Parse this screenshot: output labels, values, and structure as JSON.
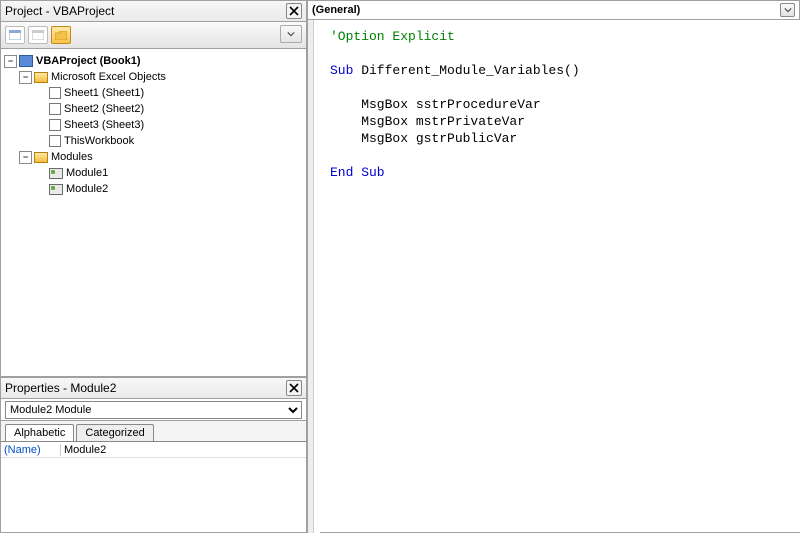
{
  "project_panel": {
    "title": "Project - VBAProject",
    "tree": {
      "root": "VBAProject (Book1)",
      "excel_objects": {
        "label": "Microsoft Excel Objects",
        "items": [
          "Sheet1 (Sheet1)",
          "Sheet2 (Sheet2)",
          "Sheet3 (Sheet3)",
          "ThisWorkbook"
        ]
      },
      "modules": {
        "label": "Modules",
        "items": [
          "Module1",
          "Module2"
        ]
      }
    }
  },
  "properties_panel": {
    "title": "Properties - Module2",
    "object_selector": "Module2 Module",
    "tabs": {
      "alphabetic": "Alphabetic",
      "categorized": "Categorized"
    },
    "rows": [
      {
        "name": "(Name)",
        "value": "Module2"
      }
    ]
  },
  "code_panel": {
    "combo_left": "(General)",
    "combo_right": "",
    "code": {
      "l1": "'Option Explicit",
      "l2_a": "Sub",
      "l2_b": " Different_Module_Variables()",
      "l3": "    MsgBox sstrProcedureVar",
      "l4": "    MsgBox mstrPrivateVar",
      "l5": "    MsgBox gstrPublicVar",
      "l6": "End Sub"
    }
  }
}
